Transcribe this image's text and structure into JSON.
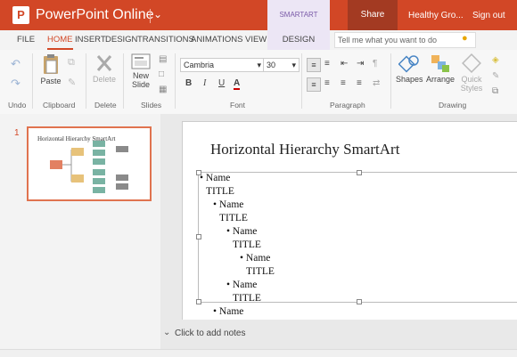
{
  "titlebar": {
    "logo_letter": "P",
    "app_title": "PowerPoint Online",
    "contextual_header": "SMARTART TOOLS",
    "share_label": "Share",
    "doc_name": "Healthy Gro...",
    "signout_label": "Sign out"
  },
  "ribbon_tabs": [
    "FILE",
    "HOME",
    "INSERT",
    "DESIGN",
    "TRANSITIONS",
    "ANIMATIONS",
    "VIEW"
  ],
  "active_tab": "HOME",
  "contextual_tab": "DESIGN",
  "tell_me_placeholder": "Tell me what you want to do",
  "ribbon": {
    "undo_group": "Undo",
    "clipboard_group": "Clipboard",
    "paste_label": "Paste",
    "delete_group": "Delete",
    "delete_label": "Delete",
    "slides_group": "Slides",
    "new_slide_line1": "New",
    "new_slide_line2": "Slide",
    "font_group": "Font",
    "font_name": "Cambria",
    "font_size": "30",
    "bold": "B",
    "italic": "I",
    "underline": "U",
    "font_color": "A",
    "paragraph_group": "Paragraph",
    "drawing_group": "Drawing",
    "shapes_label": "Shapes",
    "arrange_label": "Arrange",
    "quick_styles_line1": "Quick",
    "quick_styles_line2": "Styles"
  },
  "thumbnail": {
    "slide_number": "1",
    "title": "Horizontal Hierarchy SmartArt"
  },
  "slide": {
    "title": "Horizontal Hierarchy SmartArt",
    "bullets": [
      {
        "text": "Name",
        "level": 0,
        "bullet": true
      },
      {
        "text": "TITLE",
        "level": 0,
        "bullet": false
      },
      {
        "text": "Name",
        "level": 1,
        "bullet": true
      },
      {
        "text": "TITLE",
        "level": 1,
        "bullet": false
      },
      {
        "text": "Name",
        "level": 2,
        "bullet": true
      },
      {
        "text": "TITLE",
        "level": 2,
        "bullet": false
      },
      {
        "text": "Name",
        "level": 3,
        "bullet": true
      },
      {
        "text": "TITLE",
        "level": 3,
        "bullet": false
      },
      {
        "text": "Name",
        "level": 2,
        "bullet": true
      },
      {
        "text": "TITLE",
        "level": 2,
        "bullet": false
      },
      {
        "text": "Name",
        "level": 1,
        "bullet": true
      }
    ]
  },
  "notes_placeholder": "Click to add notes",
  "colors": {
    "accent": "#d24726",
    "smartart_tab": "#ece6f5"
  }
}
